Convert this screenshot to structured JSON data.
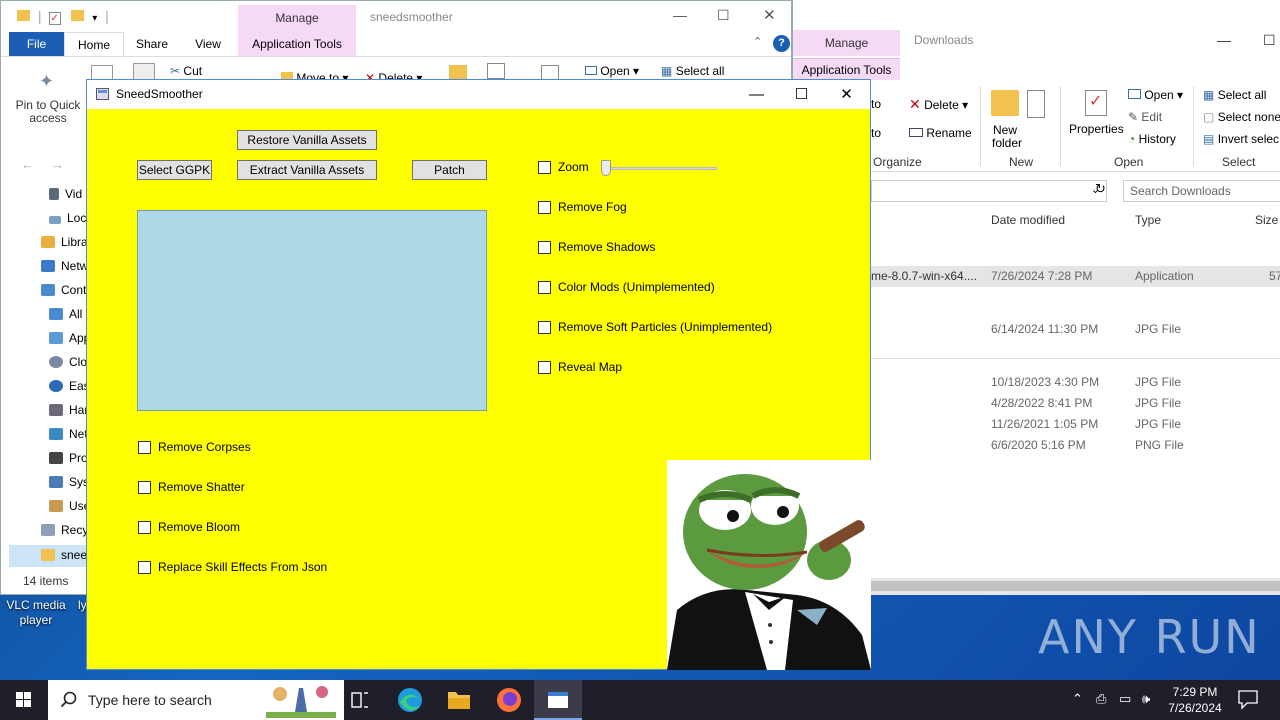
{
  "explorer_downloads": {
    "manage_tab": "Manage",
    "title": "Downloads",
    "app_tools_tab": "Application Tools",
    "ribbon": {
      "move_to": "to",
      "copy_to": "to",
      "delete": "Delete",
      "rename": "Rename",
      "new_folder": "New folder",
      "properties": "Properties",
      "open": "Open",
      "edit": "Edit",
      "history": "History",
      "select_all": "Select all",
      "select_none": "Select none",
      "invert_selection": "Invert selec",
      "groups": {
        "organize": "Organize",
        "new": "New",
        "open": "Open",
        "select": "Select"
      }
    },
    "search_placeholder": "Search Downloads",
    "columns": {
      "date": "Date modified",
      "type": "Type",
      "size": "Size"
    },
    "files": [
      {
        "name": "me-8.0.7-win-x64....",
        "date": "7/26/2024 7:28 PM",
        "type": "Application",
        "size": "57"
      },
      {
        "name": "",
        "date": "6/14/2024 11:30 PM",
        "type": "JPG File",
        "size": ""
      },
      {
        "name": "",
        "date": "10/18/2023 4:30 PM",
        "type": "JPG File",
        "size": ""
      },
      {
        "name": "",
        "date": "4/28/2022 8:41 PM",
        "type": "JPG File",
        "size": ""
      },
      {
        "name": "",
        "date": "11/26/2021 1:05 PM",
        "type": "JPG File",
        "size": ""
      },
      {
        "name": "",
        "date": "6/6/2020 5:16 PM",
        "type": "PNG File",
        "size": ""
      }
    ]
  },
  "explorer_sneed": {
    "manage_tab": "Manage",
    "title": "sneedsmoother",
    "tabs": {
      "file": "File",
      "home": "Home",
      "share": "Share",
      "view": "View",
      "app_tools": "Application Tools"
    },
    "ribbon": {
      "pin": "Pin to Quick access",
      "cut": "Cut",
      "move_to": "Move to",
      "delete": "Delete",
      "open": "Open",
      "select_all": "Select all"
    },
    "tree": [
      "Vid",
      "Loc",
      "Libra",
      "Netw",
      "Cont",
      "All",
      "App",
      "Clo",
      "Eas",
      "Har",
      "Net",
      "Pro",
      "Sys",
      "Use",
      "Recy",
      "snee"
    ],
    "status": "14 items"
  },
  "desktop": {
    "vlc_label": "VLC media player",
    "other_label": "ly"
  },
  "app": {
    "title": "SneedSmoother",
    "buttons": {
      "restore": "Restore Vanilla Assets",
      "select_ggpk": "Select GGPK",
      "extract": "Extract Vanilla Assets",
      "patch": "Patch"
    },
    "zoom_level": 0,
    "right_options": [
      "Zoom",
      "Remove Fog",
      "Remove Shadows",
      "Color Mods (Unimplemented)",
      "Remove Soft Particles (Unimplemented)",
      "Reveal Map"
    ],
    "left_options": [
      "Remove Corpses",
      "Remove Shatter",
      "Remove Bloom",
      "Replace Skill Effects From Json"
    ]
  },
  "watermark": "ANY RUN",
  "taskbar": {
    "search_placeholder": "Type here to search",
    "time": "7:29 PM",
    "date": "7/26/2024"
  },
  "colors": {
    "app_bg": "#ffff00",
    "listbox_bg": "#add8e6",
    "manage_tab": "#f5d9f5",
    "file_tab": "#1a5fb4"
  }
}
